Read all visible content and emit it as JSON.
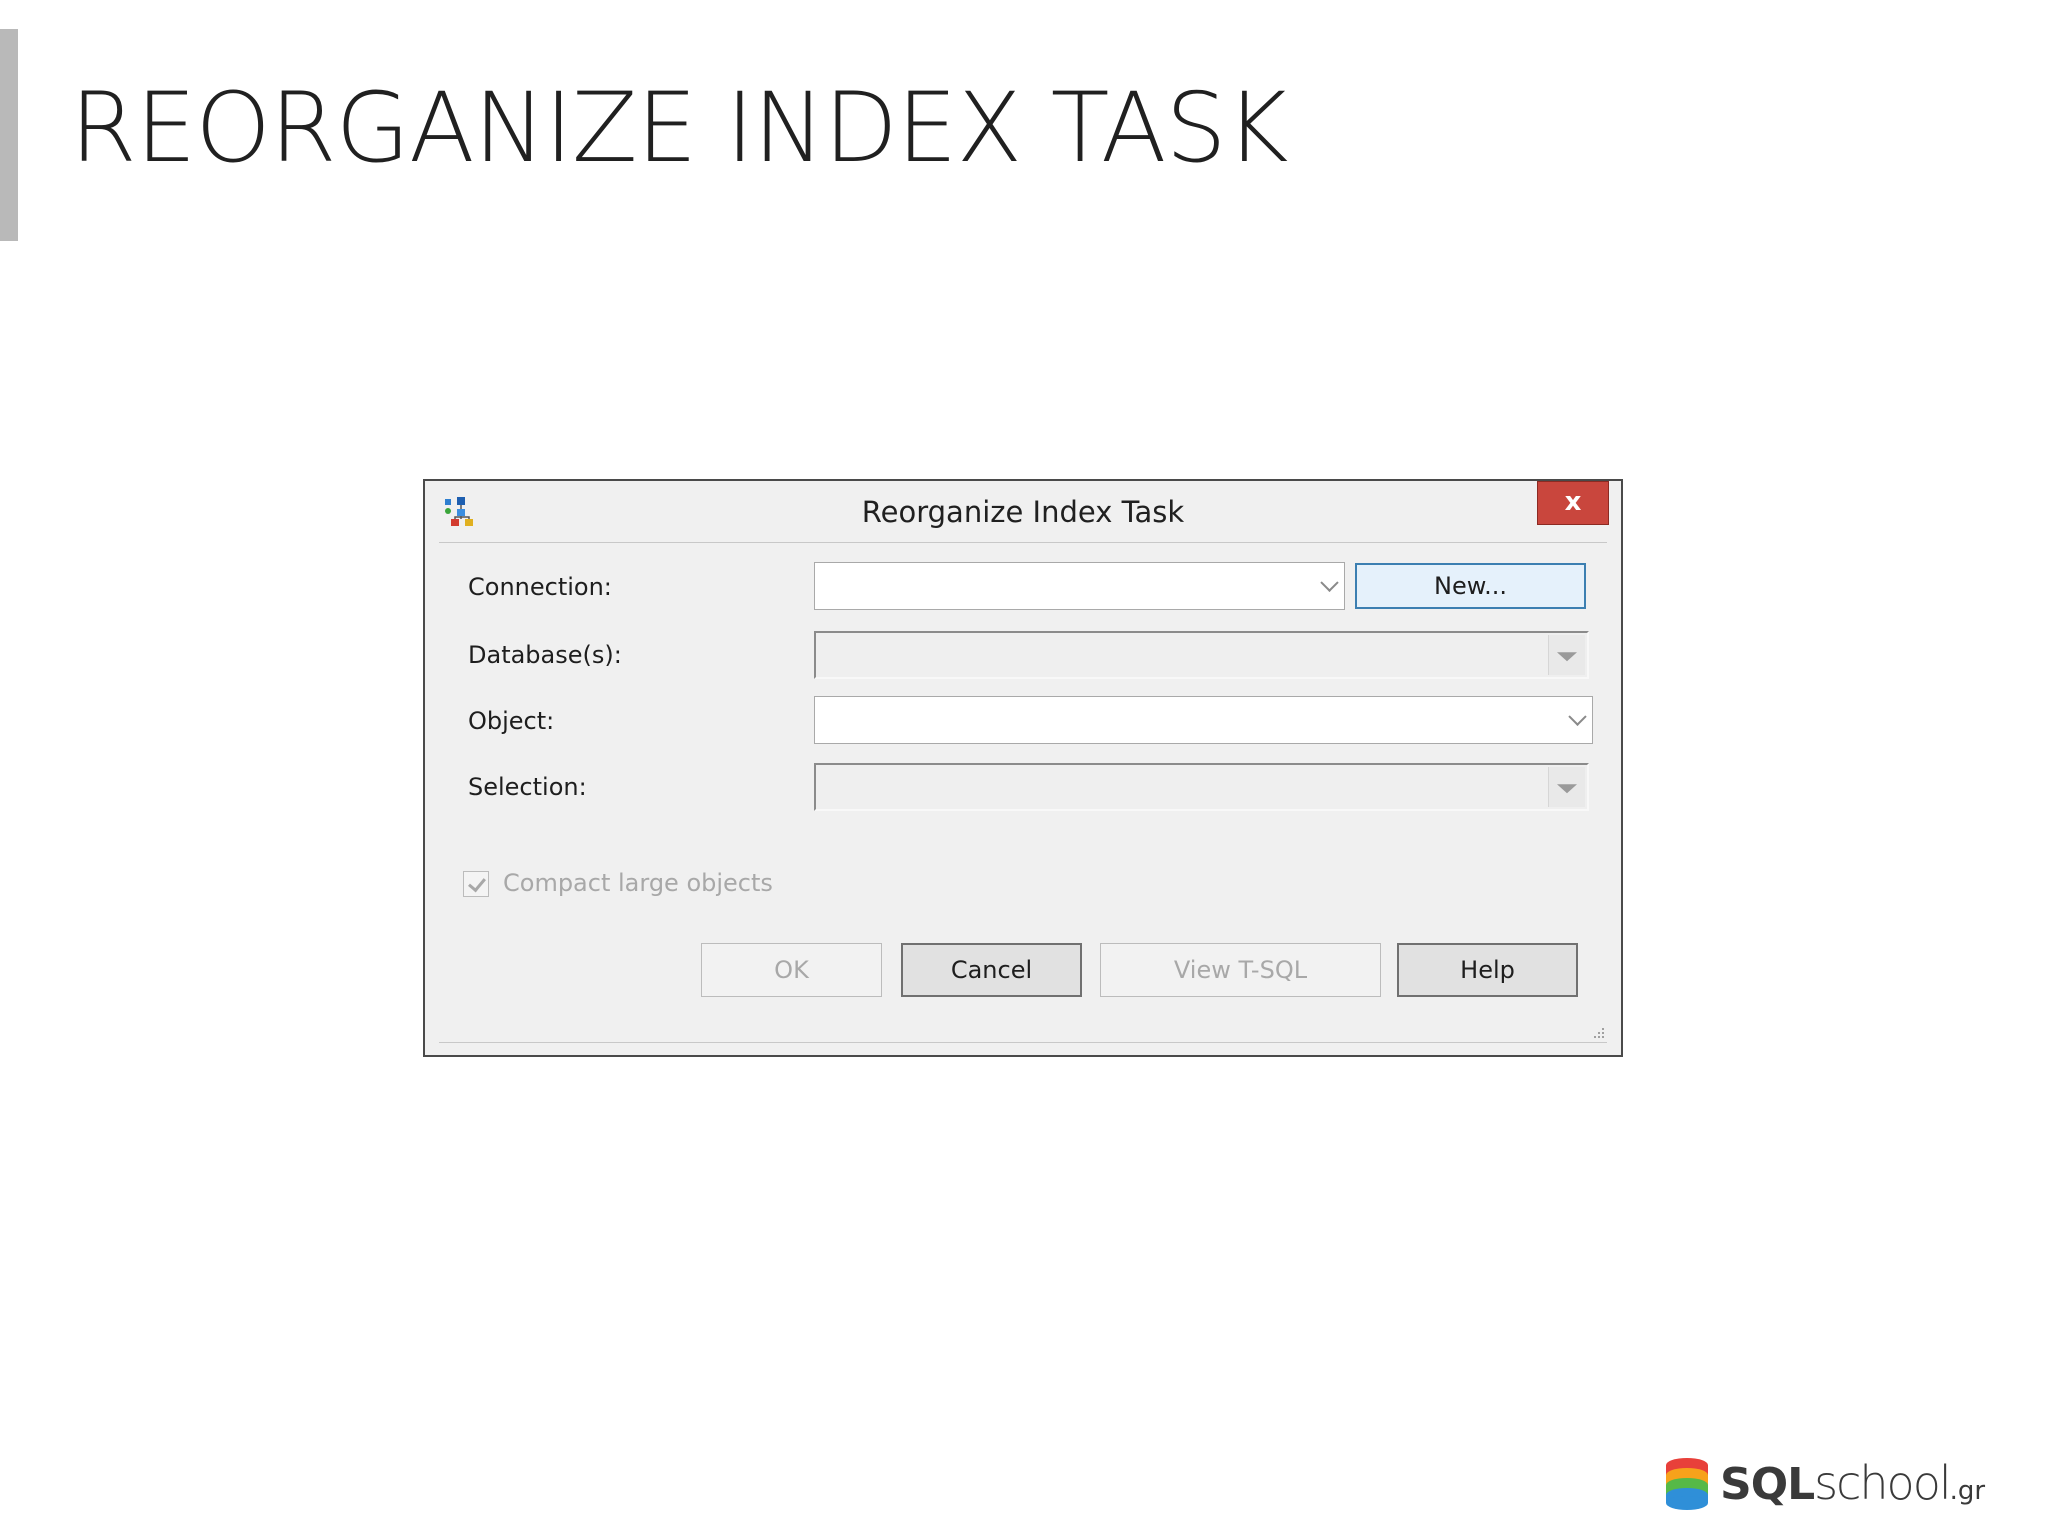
{
  "slide": {
    "title": "REORGANIZE INDEX TASK"
  },
  "dialog": {
    "title": "Reorganize Index Task",
    "close_label": "x",
    "fields": {
      "connection_label": "Connection:",
      "connection_value": "",
      "databases_label": "Database(s):",
      "databases_value": "",
      "object_label": "Object:",
      "object_value": "",
      "selection_label": "Selection:",
      "selection_value": ""
    },
    "new_button": "New...",
    "compact_checkbox": {
      "label": "Compact large objects",
      "checked": true,
      "enabled": false
    },
    "buttons": {
      "ok": "OK",
      "cancel": "Cancel",
      "view_tsql": "View T-SQL",
      "help": "Help"
    }
  },
  "logo": {
    "sql": "SQL",
    "school": "school",
    "suffix": ".gr"
  },
  "colors": {
    "close_button": "#c9463d",
    "new_button_border": "#3c7fb1",
    "disabled_text": "#a8a8a8",
    "logo_stripes": [
      "#e8403a",
      "#f7a21b",
      "#56b947",
      "#2f8fd8"
    ]
  }
}
